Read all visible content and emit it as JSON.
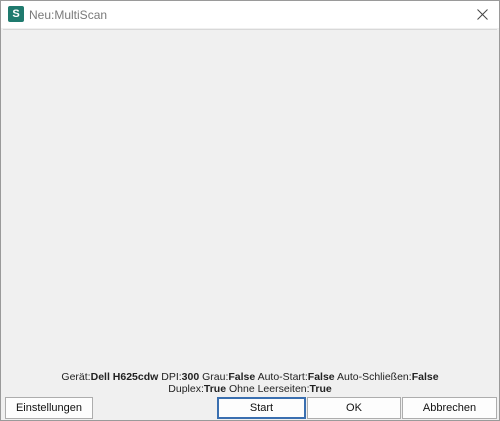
{
  "window": {
    "icon_letter": "S",
    "title": "Neu:MultiScan"
  },
  "status": {
    "device_label": "Gerät:",
    "device_value": "Dell H625cdw",
    "dpi_label": "DPI:",
    "dpi_value": "300",
    "gray_label": "Grau:",
    "gray_value": "False",
    "autostart_label": "Auto-Start:",
    "autostart_value": "False",
    "autoclose_label": "Auto-Schließen:",
    "autoclose_value": "False",
    "duplex_label": "Duplex:",
    "duplex_value": "True",
    "noblank_label": "Ohne Leerseiten:",
    "noblank_value": "True"
  },
  "buttons": {
    "settings": "Einstellungen",
    "start": "Start",
    "ok": "OK",
    "cancel": "Abbrechen"
  },
  "icons": {
    "app": "app-icon",
    "close": "close-icon"
  }
}
